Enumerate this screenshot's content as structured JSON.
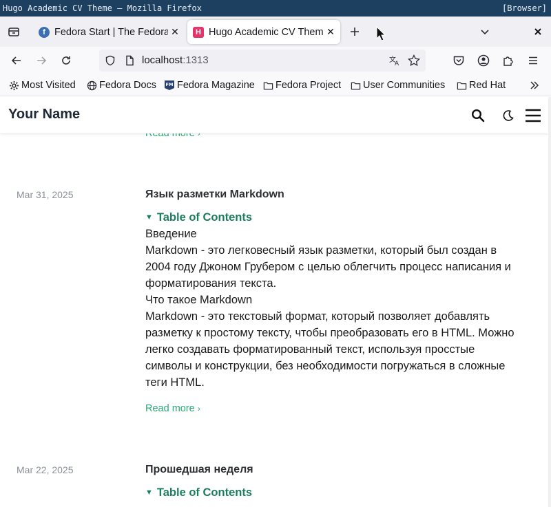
{
  "os": {
    "window_title": "Hugo Academic CV Theme — Mozilla Firefox",
    "indicator": "[Browser]"
  },
  "tabs": [
    {
      "label": "Fedora Start | The Fedora",
      "favicon": "fedora-icon",
      "active": false
    },
    {
      "label": "Hugo Academic CV Theme",
      "favicon": "hugo-icon",
      "active": true
    }
  ],
  "urlbar": {
    "host": "localhost",
    "port": ":1313"
  },
  "bookmarks": [
    {
      "label": "Most Visited",
      "icon": "gear-icon"
    },
    {
      "label": "Fedora Docs",
      "icon": "globe-icon"
    },
    {
      "label": "Fedora Magazine",
      "icon": "fm-icon"
    },
    {
      "label": "Fedora Project",
      "icon": "folder-icon"
    },
    {
      "label": "User Communities",
      "icon": "folder-icon"
    },
    {
      "label": "Red Hat",
      "icon": "folder-icon"
    }
  ],
  "site": {
    "title": "Your Name"
  },
  "read_more_label": "Read more",
  "posts": [
    {
      "date": "Mar 31, 2025",
      "title": "Язык разметки Markdown",
      "toc_label": "Table of Contents",
      "body_lines": [
        "Введение",
        "Markdown - это легковесный язык разметки, который был создан в",
        "2004 году Джоном Грубером с целью облегчить процесс написания и",
        "форматирования текста.",
        "Что такое Markdown",
        "Markdown - это текстовый формат, который позволяет добавлять",
        "разметку к простому тексту, чтобы преобразовать его в HTML. Можно",
        "легко создавать форматированный текст, используя просстые",
        "символы и конструкции, без необходимости погружаться в сложные",
        "теги HTML."
      ]
    },
    {
      "date": "Mar 22, 2025",
      "title": "Прошедшая неделя",
      "toc_label": "Table of Contents"
    }
  ],
  "colors": {
    "accent": "#2aa876",
    "toc": "#1a7f5e",
    "os_bar": "#1e4060"
  }
}
